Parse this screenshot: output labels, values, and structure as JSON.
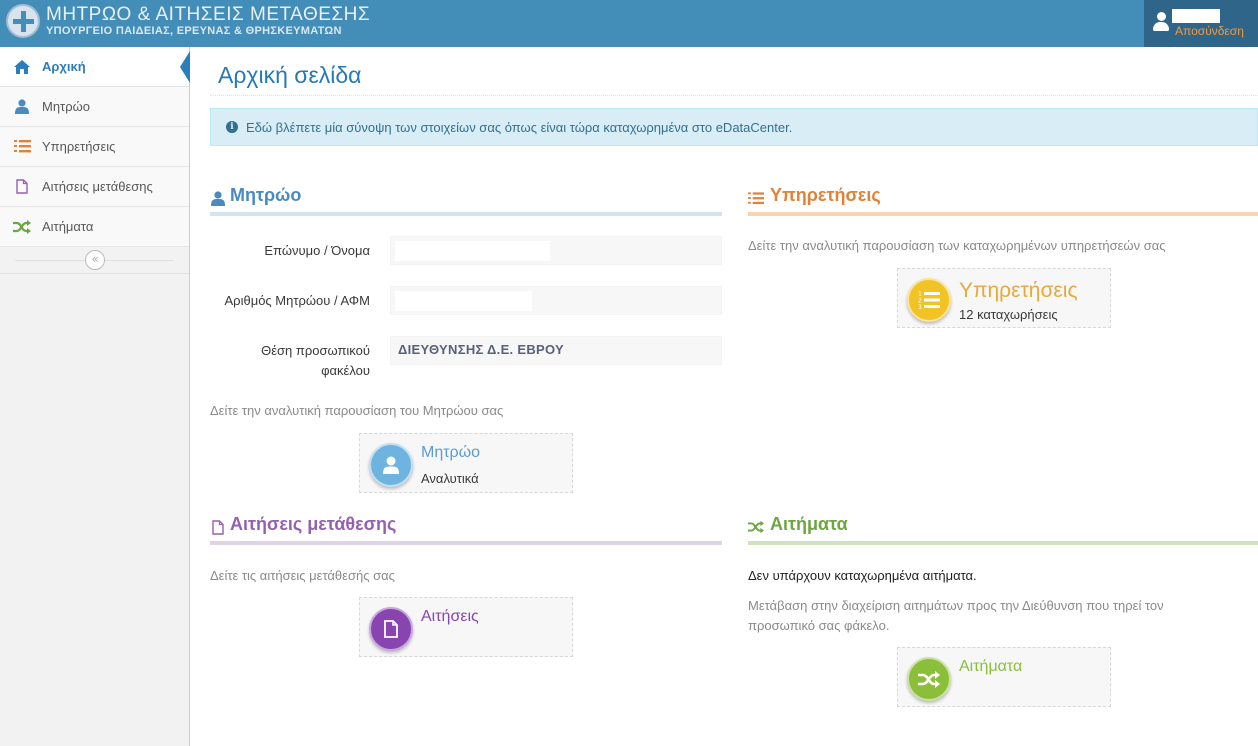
{
  "header": {
    "title": "ΜΗΤΡΩΟ & ΑΙΤΗΣΕΙΣ ΜΕΤΑΘΕΣΗΣ",
    "subtitle": "ΥΠΟΥΡΓΕΙΟ ΠΑΙΔΕΙΑΣ, ΕΡΕΥΝΑΣ & ΘΡΗΣΚΕΥΜΑΤΩΝ",
    "logout_label": "Αποσύνδεση"
  },
  "sidebar": {
    "items": [
      {
        "label": "Αρχική",
        "icon": "home-icon",
        "active": true
      },
      {
        "label": "Μητρώο",
        "icon": "user-icon"
      },
      {
        "label": "Υπηρετήσεις",
        "icon": "list-ol-icon"
      },
      {
        "label": "Αιτήσεις μετάθεσης",
        "icon": "file-icon"
      },
      {
        "label": "Αιτήματα",
        "icon": "shuffle-icon"
      }
    ]
  },
  "main": {
    "page_title": "Αρχική σελίδα",
    "info_text": "Εδώ βλέπετε μία σύνοψη των στοιχείων σας όπως είναι τώρα καταχωρημένα στο eDataCenter.",
    "mitroo": {
      "title": "Μητρώο",
      "fields": [
        {
          "label": "Επώνυμο / Όνομα",
          "value": ""
        },
        {
          "label": "Αριθμός Μητρώου / ΑΦΜ",
          "value": ""
        },
        {
          "label": "Θέση προσωπικού φακέλου",
          "value": "ΔΙΕΥΘΥΝΣΗΣ Δ.Ε. ΕΒΡΟΥ"
        }
      ],
      "description": "Δείτε την αναλυτική παρουσίαση του Μητρώου σας",
      "tile_title": "Μητρώο",
      "tile_sub": "Αναλυτικά"
    },
    "ypiretiseis": {
      "title": "Υπηρετήσεις",
      "description": "Δείτε την αναλυτική παρουσίαση των καταχωρημένων υπηρετήσεών σας",
      "tile_title": "Υπηρετήσεις",
      "tile_sub": "12 καταχωρήσεις"
    },
    "aitiseis": {
      "title": "Αιτήσεις μετάθεσης",
      "description": "Δείτε τις αιτήσεις μετάθεσής σας",
      "tile_title": "Αιτήσεις"
    },
    "aitimata": {
      "title": "Αιτήματα",
      "no_items": "Δεν υπάρχουν καταχωρημένα αιτήματα.",
      "description": "Μετάβαση στην διαχείριση αιτημάτων προς την Διεύθυνση που τηρεί τον προσωπικό σας φάκελο.",
      "tile_title": "Αιτήματα"
    }
  },
  "colors": {
    "navbar": "#438eb9",
    "primary": "#2b7dbc",
    "mitroo": "#4a8ac0",
    "ypiretiseis": "#e0823a",
    "aitiseis": "#9461b0",
    "aitimata": "#6da540"
  }
}
